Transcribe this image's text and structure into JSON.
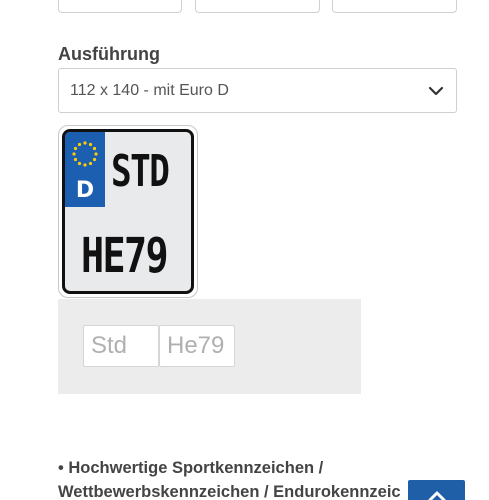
{
  "form": {
    "option_label": "Ausführung",
    "selected_size": "112 x 140 - mit Euro D"
  },
  "plate": {
    "country_code": "D",
    "line1": "STD",
    "line2": "HE79",
    "eu_blue": "#1c5fb0",
    "star_color": "#ffcc00"
  },
  "inputs": {
    "city_placeholder": "Std",
    "number_placeholder": "He79"
  },
  "description": {
    "line1": "• Hochwertige Sportkennzeichen /",
    "line2": "Wettbewerbskennzeichen / Endurokennzeic"
  },
  "colors": {
    "accent": "#1f5fa8",
    "panel_bg": "#ececec"
  },
  "icons": {
    "select_arrow": "chevron-down-icon",
    "scroll_top": "chevron-up-icon"
  }
}
